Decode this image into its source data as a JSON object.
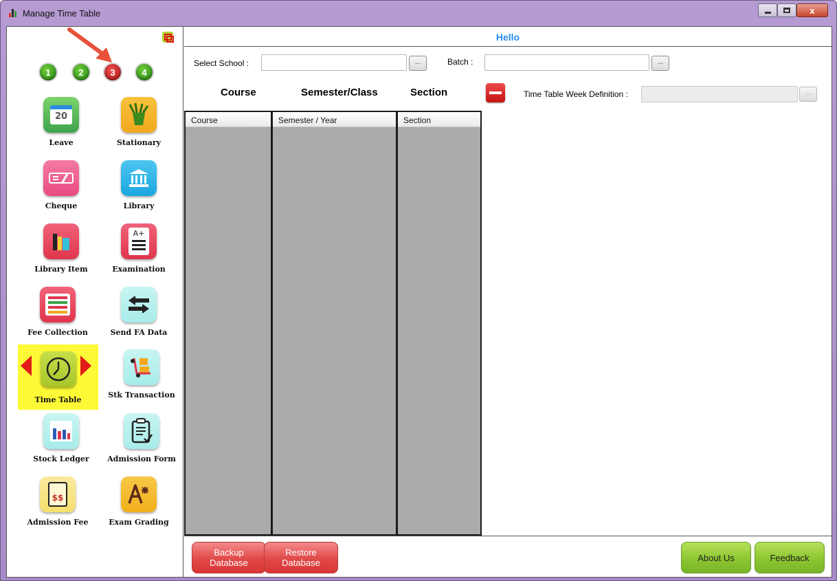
{
  "window": {
    "title": "Manage Time Table",
    "close_label": "x"
  },
  "sidebar": {
    "pages": [
      "1",
      "2",
      "3",
      "4"
    ],
    "active_page": "3",
    "items": [
      {
        "label": "Leave",
        "icon": "calendar-icon",
        "color": "#3ea34b"
      },
      {
        "label": "Stationary",
        "icon": "pencil-cup-icon",
        "color": "#f2a81d"
      },
      {
        "label": "Cheque",
        "icon": "cheque-icon",
        "color": "#e94a82"
      },
      {
        "label": "Library",
        "icon": "library-building-icon",
        "color": "#1aa7e0"
      },
      {
        "label": "Library Item",
        "icon": "books-icon",
        "color": "#e0354c"
      },
      {
        "label": "Examination",
        "icon": "exam-sheet-icon",
        "color": "#e0354c"
      },
      {
        "label": "Fee Collection",
        "icon": "list-icon",
        "color": "#e0354c"
      },
      {
        "label": "Send FA Data",
        "icon": "transfer-arrows-icon",
        "color": "#a7ece9"
      },
      {
        "label": "Time Table",
        "icon": "clock-icon",
        "color": "#b6d235"
      },
      {
        "label": "Stk Transaction",
        "icon": "hand-truck-icon",
        "color": "#a7ece9"
      },
      {
        "label": "Stock Ledger",
        "icon": "bar-ledger-icon",
        "color": "#a7ece9"
      },
      {
        "label": "Admission Form",
        "icon": "clipboard-check-icon",
        "color": "#a7ece9"
      },
      {
        "label": "Admission Fee",
        "icon": "fee-slip-icon",
        "color": "#f5df6e"
      },
      {
        "label": "Exam Grading",
        "icon": "grade-a-icon",
        "color": "#f2b01d"
      }
    ],
    "exam_badge": "A+",
    "fee_badge": "$$",
    "calendar_day": "20"
  },
  "main": {
    "greeting": "Hello",
    "select_school_label": "Select School :",
    "select_school_value": "",
    "batch_label": "Batch :",
    "batch_value": "",
    "browse_label": "...",
    "headings": {
      "course": "Course",
      "semester_class": "Semester/Class",
      "section": "Section"
    },
    "week_definition_label": "Time Table Week Definition :",
    "week_definition_value": "",
    "grids": {
      "course_header": "Course",
      "semester_header": "Semester / Year",
      "section_header": "Section"
    }
  },
  "footer": {
    "backup_label": "Backup\nDatabase",
    "restore_label": "Restore\nDatabase",
    "about_label": "About Us",
    "feedback_label": "Feedback"
  },
  "colors": {
    "accent_text": "#2b8bf0",
    "active_highlight": "#fdf936",
    "red_button": "#e04848",
    "green_button": "#8cc630"
  }
}
